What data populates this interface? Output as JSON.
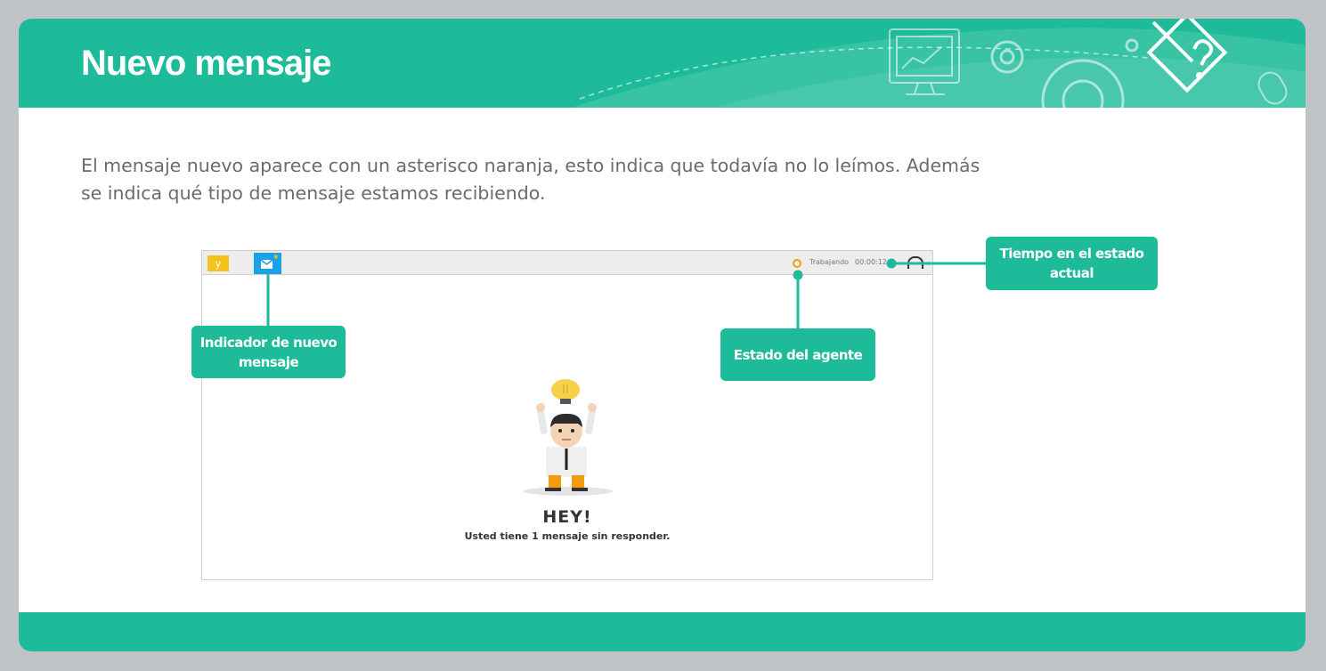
{
  "slide": {
    "title": "Nuevo mensaje",
    "intro_line1": "El mensaje nuevo aparece con un asterisco naranja, esto indica que todavía no lo leímos. Además",
    "intro_line2": "se indica qué tipo de mensaje estamos recibiendo."
  },
  "app_screenshot": {
    "top_bar": {
      "tile_y_label": "y",
      "status_label": "Trabajando",
      "timer": "00:00:12"
    },
    "empty_state": {
      "heading": "HEY!",
      "message": "Usted tiene 1 mensaje sin responder."
    }
  },
  "callouts": {
    "new_message": "Indicador de nuevo mensaje",
    "agent_status": "Estado del agente",
    "time_in_state": "Tiempo en el estado actual"
  },
  "colors": {
    "brand": "#1dbb99",
    "background": "#bfc3c6",
    "status": "#f39c12",
    "message_tile": "#1aa1e6",
    "y_tile": "#f4c21a"
  },
  "icons": [
    "mail-new-icon",
    "status-dot-icon",
    "headset-icon",
    "gear-icon",
    "monitor-icon",
    "edit-badge-icon",
    "mouse-icon",
    "lightbulb-icon"
  ]
}
